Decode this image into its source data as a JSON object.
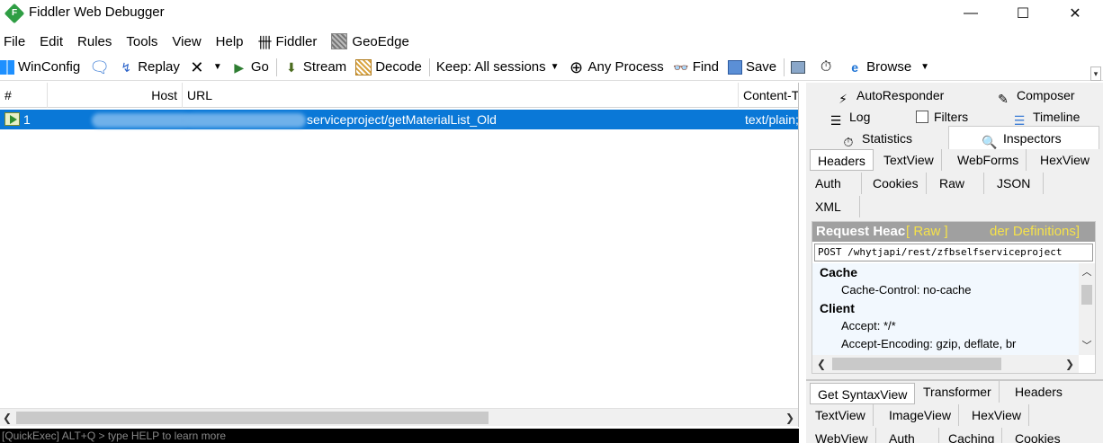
{
  "window": {
    "title": "Fiddler Web Debugger",
    "logo_letter": "F",
    "minimize_glyph": "—",
    "maximize_glyph": "☐",
    "close_glyph": "✕"
  },
  "menu": {
    "items": [
      "File",
      "Edit",
      "Rules",
      "Tools",
      "View",
      "Help",
      "Fiddler",
      "GeoEdge"
    ],
    "fiddler_icon": "fiddler-logo-icon",
    "geoedge_icon": "geoedge-icon"
  },
  "toolbar": {
    "winconfig": "WinConfig",
    "replay": "Replay",
    "go": "Go",
    "stream": "Stream",
    "decode": "Decode",
    "keep": "Keep: All sessions",
    "any_process": "Any Process",
    "find": "Find",
    "save": "Save",
    "browse": "Browse"
  },
  "grid": {
    "columns": [
      "#",
      "Host",
      "URL",
      "Content-T"
    ],
    "rows": [
      {
        "num": "1",
        "url": "serviceproject/getMaterialList_Old",
        "content_type": "text/plain;"
      }
    ],
    "selection_color": "#0a78d7"
  },
  "quickexec": {
    "text": "[QuickExec] ALT+Q > type HELP to learn more"
  },
  "right_panel": {
    "tabs_row1": [
      "AutoResponder",
      "Composer"
    ],
    "tabs_row2": [
      "Log",
      "Filters",
      "Timeline"
    ],
    "tabs_row3": [
      "Statistics",
      "Inspectors"
    ],
    "request_tabs_row1": [
      "Headers",
      "TextView",
      "WebForms",
      "HexView"
    ],
    "request_tabs_row2": [
      "Auth",
      "Cookies",
      "Raw",
      "JSON"
    ],
    "request_tabs_row3": [
      "XML"
    ],
    "request_headers": {
      "title": "Request Heac",
      "raw_link": "[ Raw ]",
      "defs_link": "der Definitions]",
      "request_line": "POST /whytjapi/rest/zfbselfserviceproject",
      "groups": [
        {
          "name": "Cache",
          "items": [
            "Cache-Control: no-cache"
          ]
        },
        {
          "name": "Client",
          "items": [
            "Accept: */*",
            "Accept-Encoding: gzip, deflate, br"
          ]
        }
      ]
    },
    "response_tabs_row1": [
      "Get SyntaxView",
      "Transformer",
      "Headers"
    ],
    "response_tabs_row2": [
      "TextView",
      "ImageView",
      "HexView"
    ],
    "response_tabs_row3": [
      "WebView",
      "Auth",
      "Caching",
      "Cookies"
    ]
  }
}
